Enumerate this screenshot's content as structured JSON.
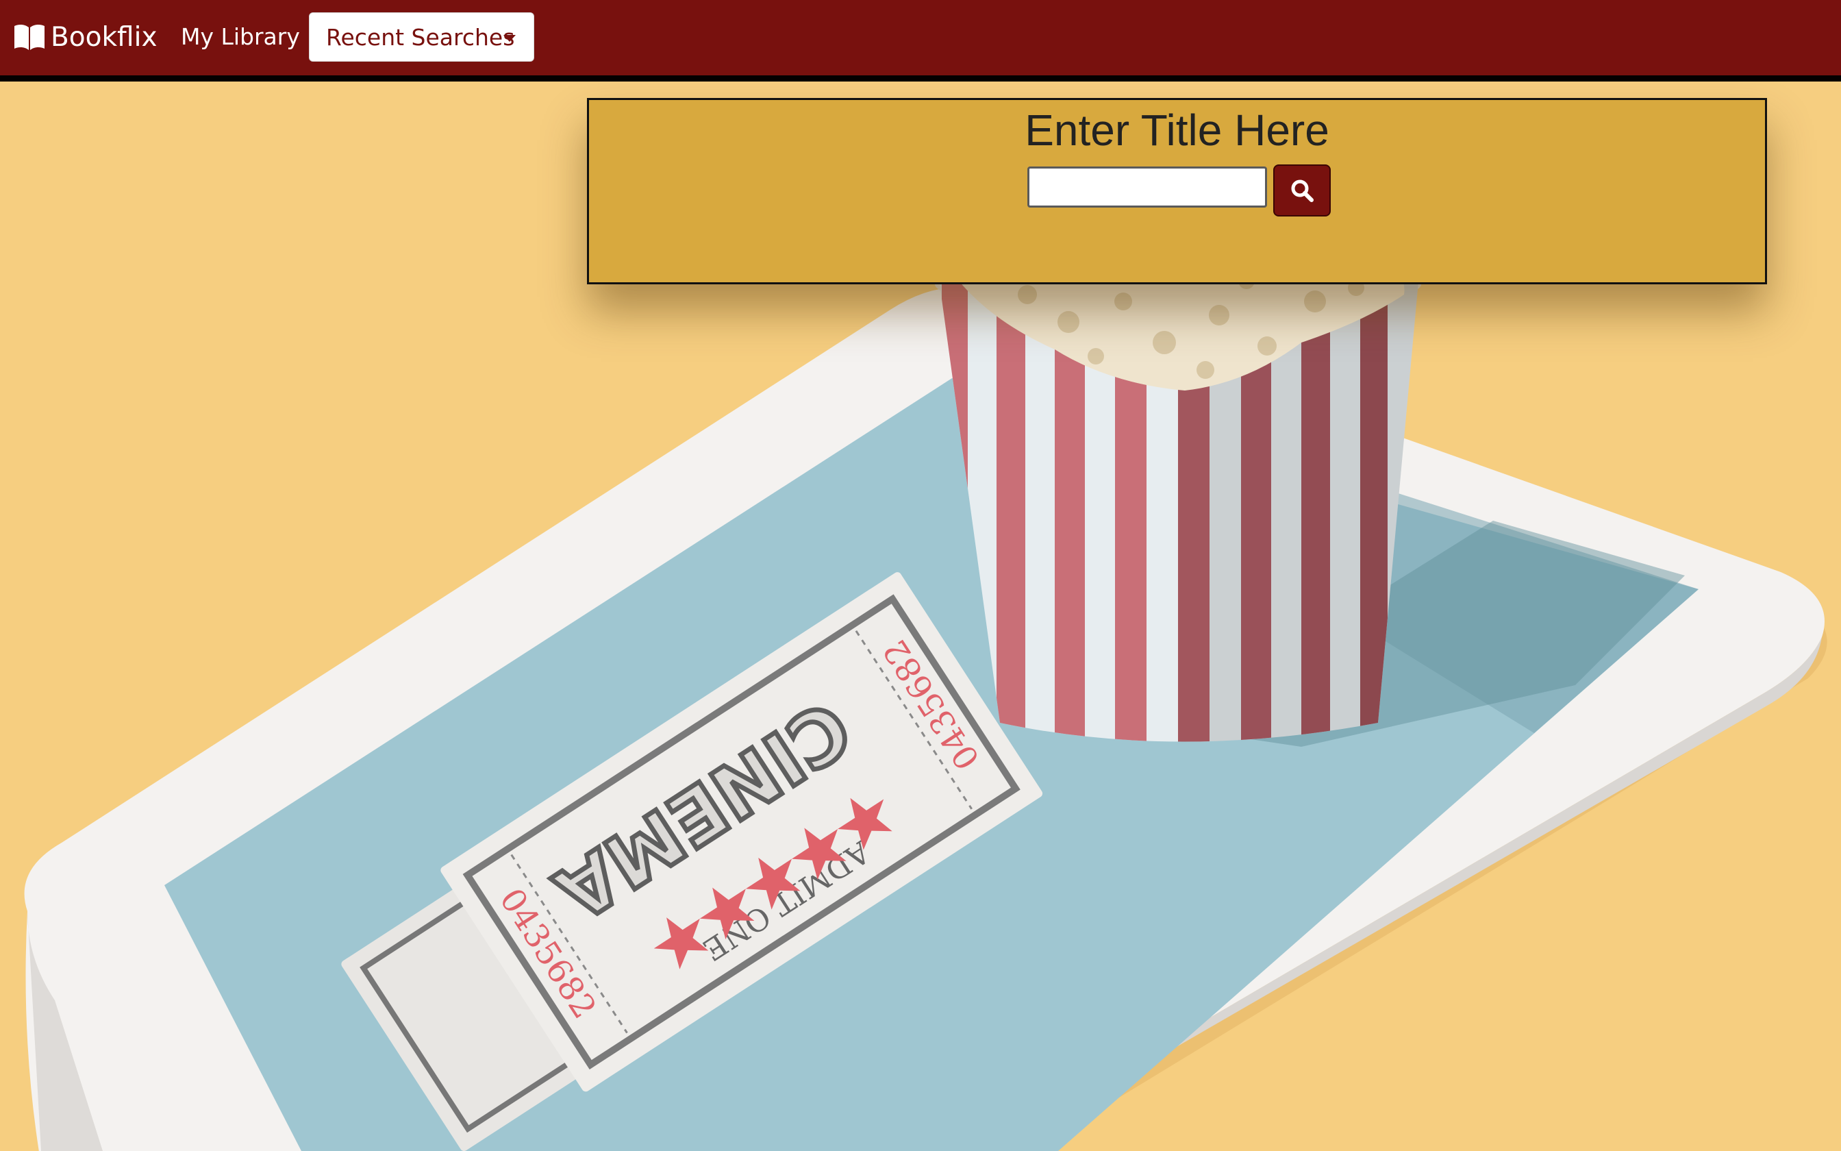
{
  "navbar": {
    "brand": "Bookflix",
    "brand_icon": "open-book-icon",
    "my_library": "My Library",
    "recent_searches": "Recent Searches",
    "dropdown_icon": "caret-down-icon"
  },
  "search": {
    "heading": "Enter Title Here",
    "input_value": "",
    "placeholder": "",
    "button_icon": "search-icon"
  },
  "hero": {
    "ticket_title": "CINEMA",
    "ticket_admit": "ADMIT ONE",
    "ticket_number": "0435682",
    "stars": 5
  },
  "colors": {
    "navbar_bg": "#78110e",
    "panel_bg": "#d8a93e",
    "page_bg": "#f6ce80",
    "screen": "#9fc6d1",
    "accent_red": "#e0626a"
  }
}
